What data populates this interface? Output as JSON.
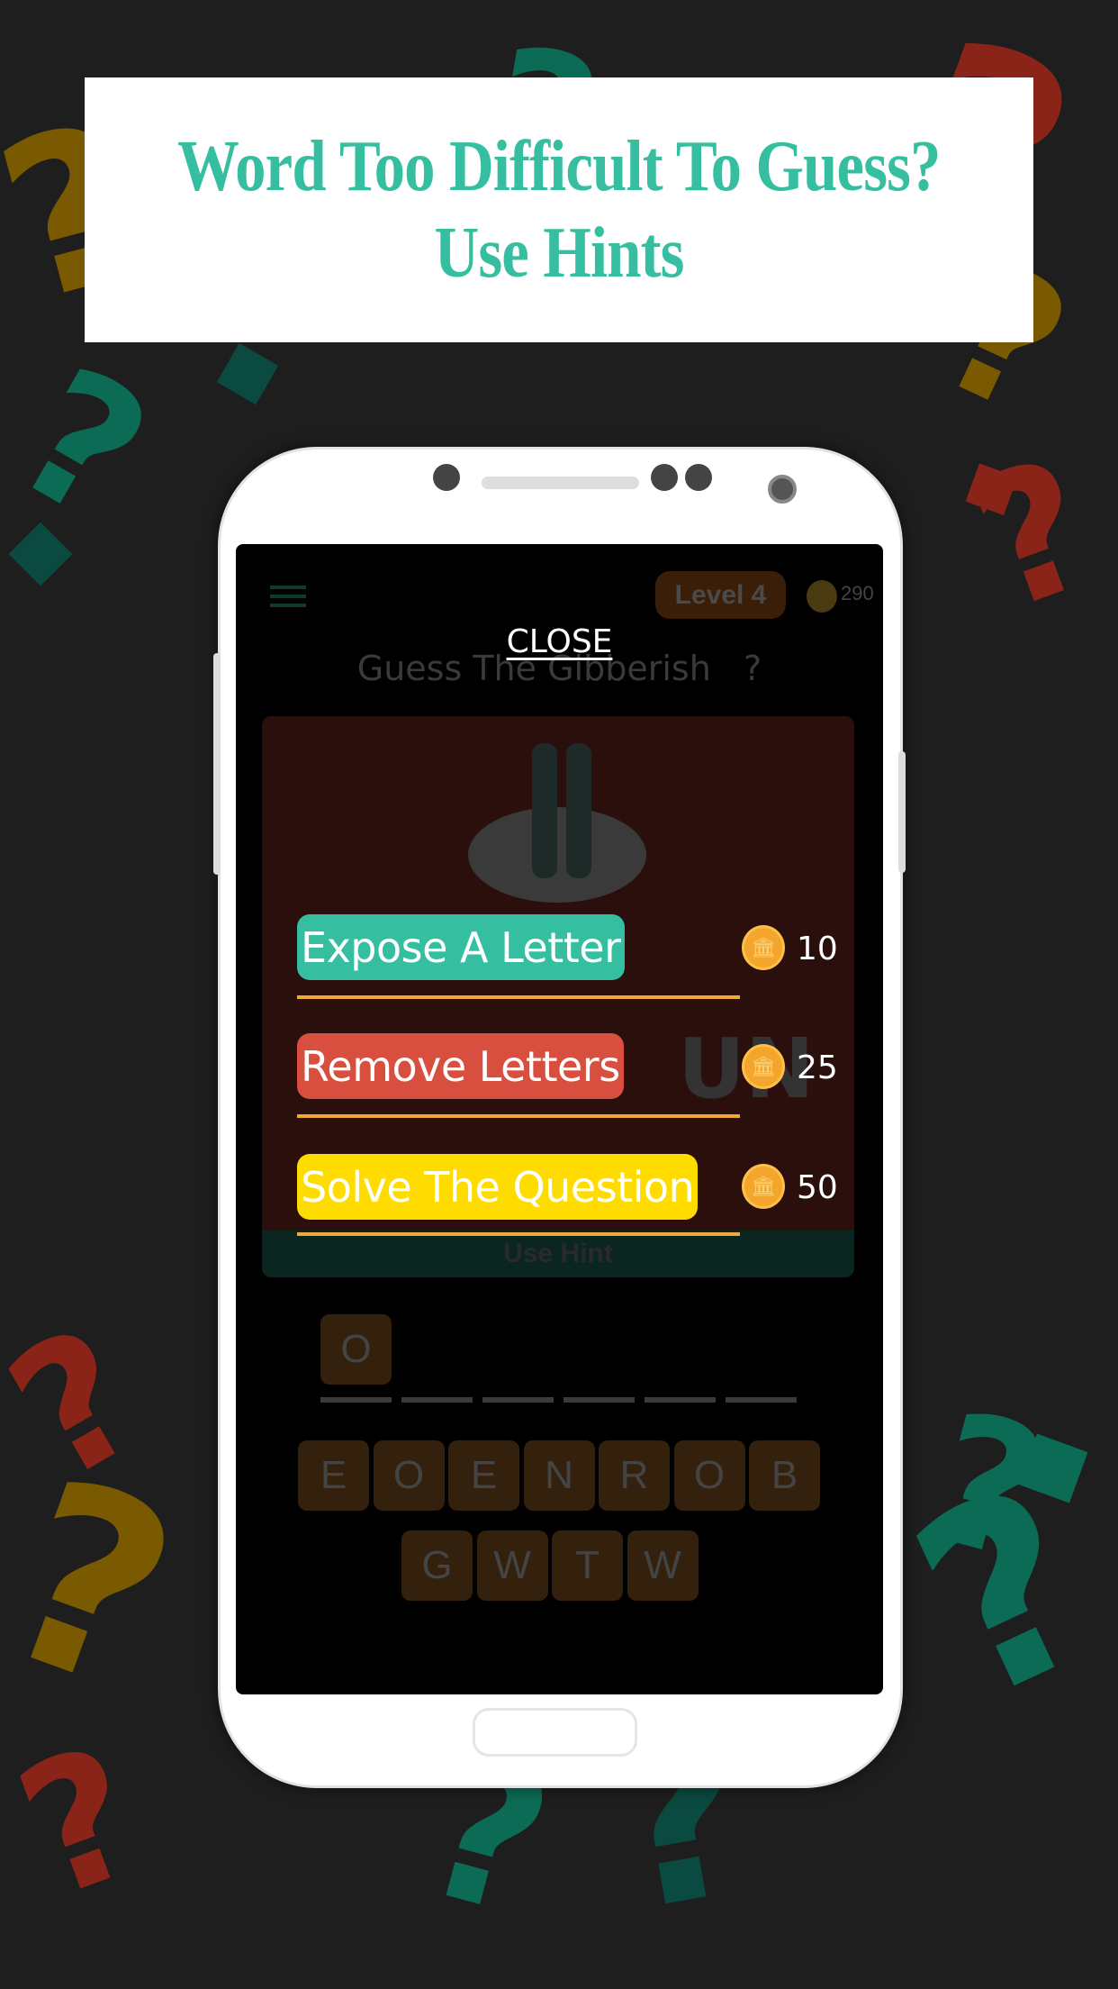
{
  "banner": {
    "line1": "Word Too Difficult To Guess?",
    "line2": "Use Hints"
  },
  "colors": {
    "accent": "#35bfa0",
    "expose": "#35bfa0",
    "remove": "#d94f3f",
    "solve": "#ffdc00",
    "underline": "#f0a83a",
    "background": "#1e1e1e"
  },
  "game": {
    "menu_icon": "hamburger-icon",
    "level": "Level 4",
    "coins": "290",
    "title": "Guess The Gibberish",
    "title_suffix": "?",
    "close": "CLOSE",
    "ghost_text": "UN",
    "use_hint": "Use Hint",
    "hints": [
      {
        "label": "Expose A Letter",
        "cost": "10",
        "icon": "coin-icon"
      },
      {
        "label": "Remove Letters",
        "cost": "25",
        "icon": "coin-icon"
      },
      {
        "label": "Solve The Question",
        "cost": "50",
        "icon": "coin-icon"
      }
    ],
    "answer": [
      "O",
      "",
      "",
      "",
      "",
      ""
    ],
    "keys_row1": [
      "E",
      "O",
      "E",
      "N",
      "R",
      "O",
      "B"
    ],
    "keys_row2": [
      "G",
      "W",
      "T",
      "W"
    ]
  }
}
